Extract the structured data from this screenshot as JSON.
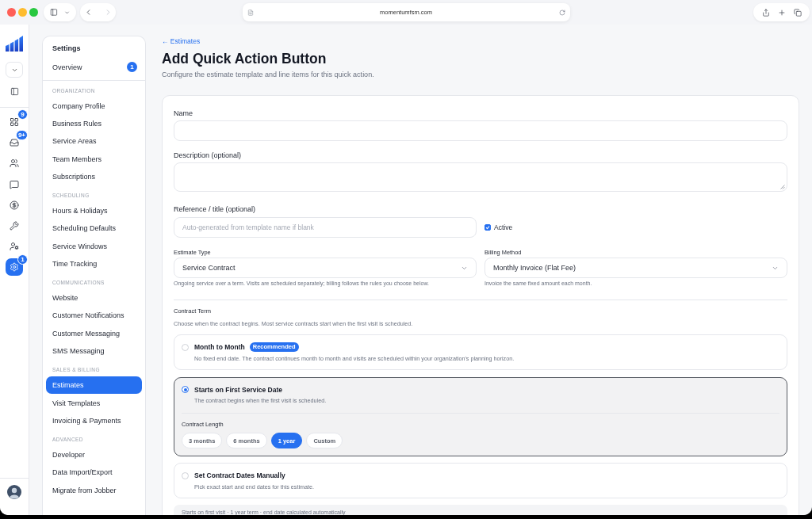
{
  "browser": {
    "url": "momentumfsm.com",
    "forward_disabled": true
  },
  "rail": {
    "items": [
      {
        "badge": "9",
        "selected": false
      },
      {
        "badge": "9+",
        "selected": false
      },
      {
        "selected": false
      },
      {
        "selected": false
      },
      {
        "selected": false
      },
      {
        "selected": false
      },
      {
        "selected": false
      },
      {
        "badge": "1",
        "selected": true
      }
    ]
  },
  "settings_nav": {
    "title": "Settings",
    "overview": {
      "label": "Overview",
      "badge": "1",
      "selected": false
    },
    "sections": [
      {
        "heading": "ORGANIZATION",
        "items": [
          {
            "label": "Company Profile",
            "selected": false
          },
          {
            "label": "Business Rules",
            "selected": false
          },
          {
            "label": "Service Areas",
            "selected": false
          },
          {
            "label": "Team Members",
            "selected": false
          },
          {
            "label": "Subscriptions",
            "selected": false
          }
        ]
      },
      {
        "heading": "SCHEDULING",
        "items": [
          {
            "label": "Hours & Holidays",
            "selected": false
          },
          {
            "label": "Scheduling Defaults",
            "selected": false
          },
          {
            "label": "Service Windows",
            "selected": false
          },
          {
            "label": "Time Tracking",
            "selected": false
          }
        ]
      },
      {
        "heading": "COMMUNICATIONS",
        "items": [
          {
            "label": "Website",
            "selected": false
          },
          {
            "label": "Customer Notifications",
            "selected": false
          },
          {
            "label": "Customer Messaging",
            "selected": false
          },
          {
            "label": "SMS Messaging",
            "selected": false
          }
        ]
      },
      {
        "heading": "SALES & BILLING",
        "items": [
          {
            "label": "Estimates",
            "selected": true
          },
          {
            "label": "Visit Templates",
            "selected": false
          },
          {
            "label": "Invoicing & Payments",
            "selected": false
          }
        ]
      },
      {
        "heading": "ADVANCED",
        "items": [
          {
            "label": "Developer",
            "selected": false
          },
          {
            "label": "Data Import/Export",
            "selected": false
          },
          {
            "label": "Migrate from Jobber",
            "selected": false
          }
        ]
      }
    ]
  },
  "page": {
    "back_link": "← Estimates",
    "title": "Add Quick Action Button",
    "subtitle": "Configure the estimate template and line items for this quick action."
  },
  "form": {
    "name": {
      "label": "Name"
    },
    "description": {
      "label": "Description (optional)"
    },
    "reference": {
      "label": "Reference / title (optional)",
      "placeholder": "Auto-generated from template name if blank"
    },
    "active": {
      "label": "Active",
      "checked": true
    },
    "estimate_type": {
      "label": "Estimate Type",
      "value": "Service Contract",
      "hint": "Ongoing service over a term. Visits are scheduled separately; billing follows the rules you choose below."
    },
    "billing_method": {
      "label": "Billing Method",
      "value": "Monthly Invoice (Flat Fee)",
      "hint": "Invoice the same fixed amount each month."
    },
    "contract_term": {
      "label": "Contract Term",
      "description": "Choose when the contract begins. Most service contracts start when the first visit is scheduled.",
      "options": [
        {
          "title": "Month to Month",
          "badge": "Recommended",
          "description": "No fixed end date. The contract continues month to month and visits are scheduled within your organization's planning horizon.",
          "selected": false
        },
        {
          "title": "Starts on First Service Date",
          "description": "The contract begins when the first visit is scheduled.",
          "selected": true,
          "length": {
            "label": "Contract Length",
            "choices": [
              {
                "label": "3 months",
                "selected": false
              },
              {
                "label": "6 months",
                "selected": false
              },
              {
                "label": "1 year",
                "selected": true
              },
              {
                "label": "Custom",
                "selected": false
              }
            ]
          }
        },
        {
          "title": "Set Contract Dates Manually",
          "description": "Pick exact start and end dates for this estimate.",
          "selected": false
        }
      ]
    },
    "summary": "Starts on first visit · 1 year term · end date calculated automatically"
  }
}
